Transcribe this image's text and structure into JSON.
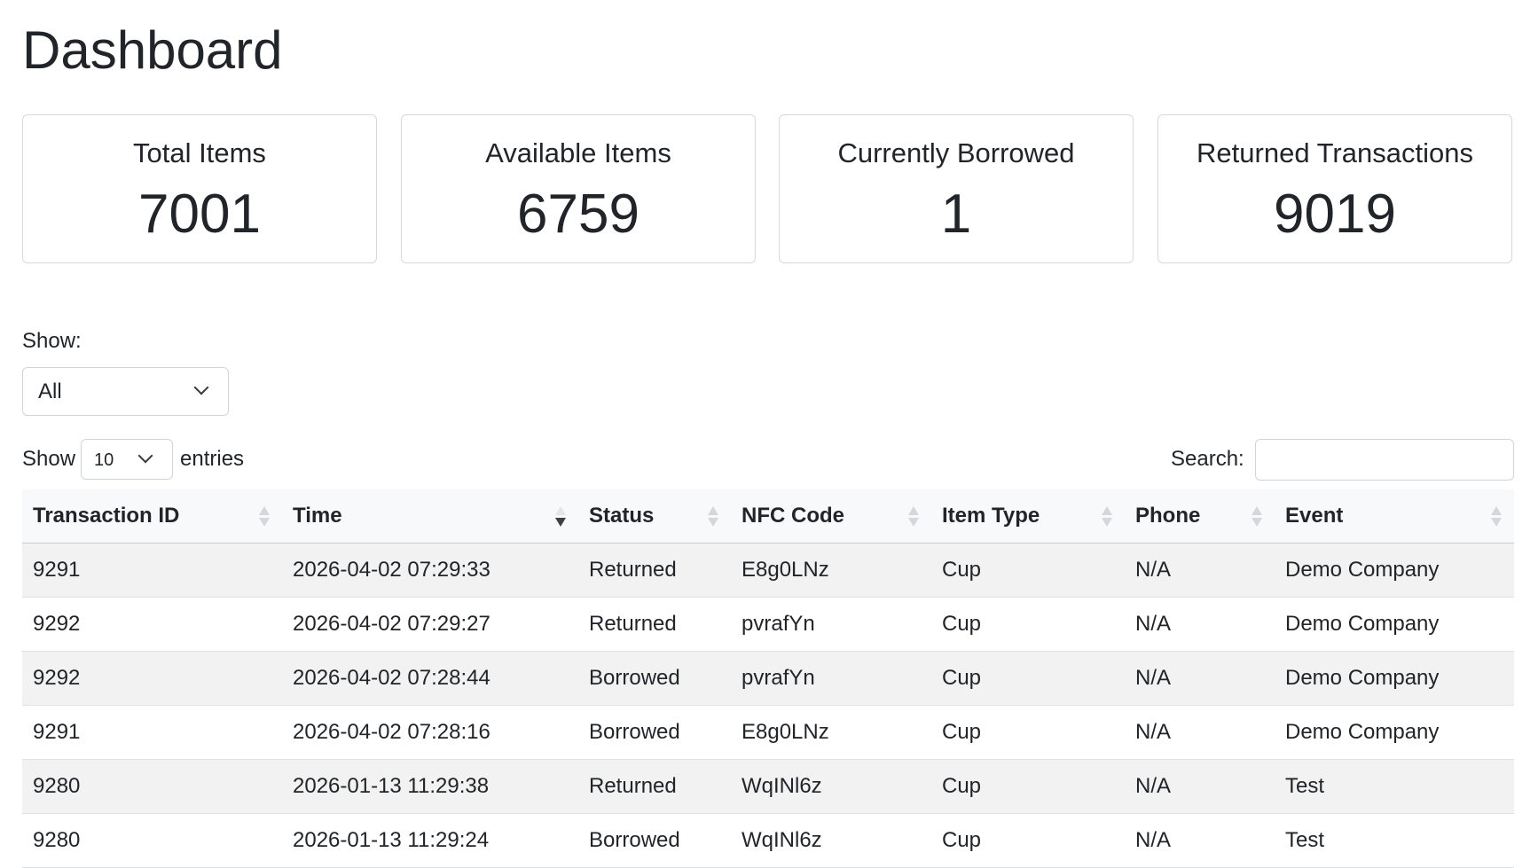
{
  "page": {
    "title": "Dashboard"
  },
  "stats": [
    {
      "label": "Total Items",
      "value": "7001"
    },
    {
      "label": "Available Items",
      "value": "6759"
    },
    {
      "label": "Currently Borrowed",
      "value": "1"
    },
    {
      "label": "Returned Transactions",
      "value": "9019"
    }
  ],
  "filter": {
    "label": "Show:",
    "selected": "All"
  },
  "table_controls": {
    "length_prefix": "Show",
    "length_value": "10",
    "length_suffix": "entries",
    "search_label": "Search:",
    "search_value": ""
  },
  "table": {
    "columns": [
      "Transaction ID",
      "Time",
      "Status",
      "NFC Code",
      "Item Type",
      "Phone",
      "Event"
    ],
    "sorted_column": "Time",
    "sort_direction": "descending",
    "rows": [
      [
        "9291",
        "2026-04-02 07:29:33",
        "Returned",
        "E8g0LNz",
        "Cup",
        "N/A",
        "Demo Company"
      ],
      [
        "9292",
        "2026-04-02 07:29:27",
        "Returned",
        "pvrafYn",
        "Cup",
        "N/A",
        "Demo Company"
      ],
      [
        "9292",
        "2026-04-02 07:28:44",
        "Borrowed",
        "pvrafYn",
        "Cup",
        "N/A",
        "Demo Company"
      ],
      [
        "9291",
        "2026-04-02 07:28:16",
        "Borrowed",
        "E8g0LNz",
        "Cup",
        "N/A",
        "Demo Company"
      ],
      [
        "9280",
        "2026-01-13 11:29:38",
        "Returned",
        "WqINl6z",
        "Cup",
        "N/A",
        "Test"
      ],
      [
        "9280",
        "2026-01-13 11:29:24",
        "Borrowed",
        "WqINl6z",
        "Cup",
        "N/A",
        "Test"
      ]
    ]
  },
  "colors": {
    "text": "#212529",
    "border": "#d6d8db",
    "header_bg": "#f8f9fa",
    "stripe_bg": "#f2f2f2"
  }
}
